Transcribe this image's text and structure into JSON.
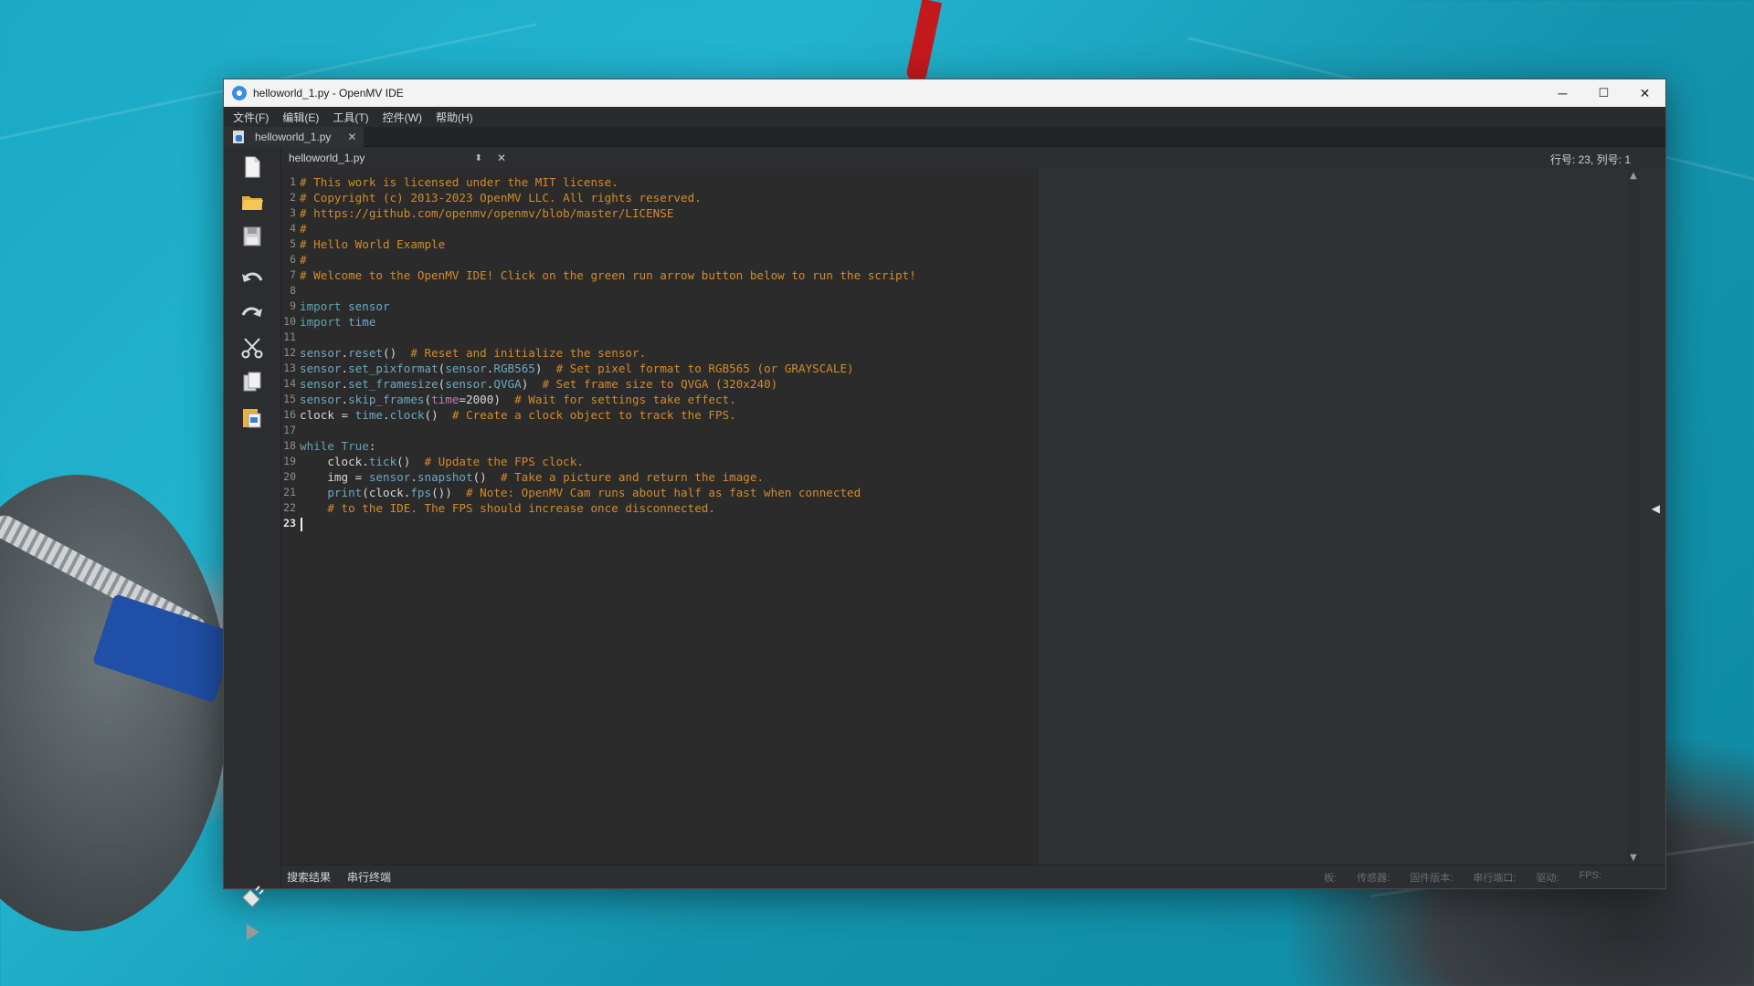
{
  "window": {
    "title": "helloworld_1.py - OpenMV IDE",
    "minimize": "─",
    "maximize": "☐",
    "close": "✕"
  },
  "menubar": [
    "文件(F)",
    "编辑(E)",
    "工具(T)",
    "控件(W)",
    "帮助(H)"
  ],
  "tab": {
    "label": "helloworld_1.py",
    "close": "✕"
  },
  "editor_header": {
    "file": "helloworld_1.py",
    "combo_arrows": "⬍",
    "close": "✕",
    "cursor_position": "行号: 23, 列号: 1"
  },
  "code_lines": [
    {
      "n": "1",
      "html": "<span class='c-comment'># This work is licensed under the MIT license.</span>"
    },
    {
      "n": "2",
      "html": "<span class='c-comment'># Copyright (c) 2013-2023 OpenMV LLC. All rights reserved.</span>"
    },
    {
      "n": "3",
      "html": "<span class='c-comment'># https://github.com/openmv/openmv/blob/master/LICENSE</span>"
    },
    {
      "n": "4",
      "html": "<span class='c-comment'>#</span>"
    },
    {
      "n": "5",
      "html": "<span class='c-comment'># Hello World Example</span>"
    },
    {
      "n": "6",
      "html": "<span class='c-comment'>#</span>"
    },
    {
      "n": "7",
      "html": "<span class='c-comment'># Welcome to the OpenMV IDE! Click on the green run arrow button below to run the script!</span>"
    },
    {
      "n": "8",
      "html": ""
    },
    {
      "n": "9",
      "html": "<span class='c-kw'>import</span> <span class='c-mod'>sensor</span>"
    },
    {
      "n": "10",
      "html": "<span class='c-kw'>import</span> <span class='c-mod'>time</span>"
    },
    {
      "n": "11",
      "html": ""
    },
    {
      "n": "12",
      "html": "<span class='c-mod'>sensor</span>.<span class='c-fn'>reset</span>()  <span class='c-comment'># Reset and initialize the sensor.</span>"
    },
    {
      "n": "13",
      "html": "<span class='c-mod'>sensor</span>.<span class='c-fn'>set_pixformat</span>(<span class='c-mod'>sensor</span>.<span class='c-fn'>RGB565</span>)  <span class='c-comment'># Set pixel format to RGB565 (or GRAYSCALE)</span>"
    },
    {
      "n": "14",
      "html": "<span class='c-mod'>sensor</span>.<span class='c-fn'>set_framesize</span>(<span class='c-mod'>sensor</span>.<span class='c-fn'>QVGA</span>)  <span class='c-comment'># Set frame size to QVGA (320x240)</span>"
    },
    {
      "n": "15",
      "html": "<span class='c-mod'>sensor</span>.<span class='c-fn'>skip_frames</span>(<span class='c-kwarg'>time</span>=2000)  <span class='c-comment'># Wait for settings take effect.</span>"
    },
    {
      "n": "16",
      "html": "clock = <span class='c-mod'>time</span>.<span class='c-fn'>clock</span>()  <span class='c-comment'># Create a clock object to track the FPS.</span>"
    },
    {
      "n": "17",
      "html": ""
    },
    {
      "n": "18",
      "html": "<span class='c-kw'>while</span> <span class='c-kw'>True</span>:"
    },
    {
      "n": "19",
      "html": "    clock.<span class='c-fn'>tick</span>()  <span class='c-comment'># Update the FPS clock.</span>"
    },
    {
      "n": "20",
      "html": "    img = <span class='c-mod'>sensor</span>.<span class='c-fn'>snapshot</span>()  <span class='c-comment'># Take a picture and return the image.</span>"
    },
    {
      "n": "21",
      "html": "    <span class='c-fn'>print</span>(clock.<span class='c-fn'>fps</span>())  <span class='c-comment'># Note: OpenMV Cam runs about half as fast when connected</span>"
    },
    {
      "n": "22",
      "html": "    <span class='c-comment'># to the IDE. The FPS should increase once disconnected.</span>"
    },
    {
      "n": "23",
      "html": "<span class='caret'></span>",
      "current": true
    }
  ],
  "sidebar_icons": [
    "new-file-icon",
    "open-folder-icon",
    "save-icon",
    "undo-icon",
    "redo-icon",
    "cut-icon",
    "copy-icon",
    "paste-icon",
    "connect-icon",
    "run-icon"
  ],
  "statusbar": {
    "tabs": [
      "搜索结果",
      "串行终端"
    ],
    "info": [
      "板:",
      "传感器:",
      "固件版本:",
      "串行端口:",
      "驱动:",
      "FPS:"
    ]
  },
  "scroll": {
    "up": "▲",
    "down": "▼",
    "collapse": "◀"
  }
}
